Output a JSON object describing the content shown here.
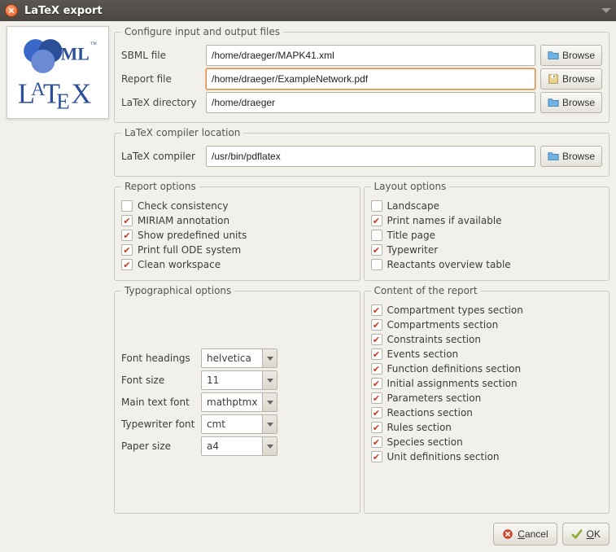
{
  "window": {
    "title": "LaTeX export"
  },
  "fieldset_io": {
    "legend": "Configure input and output files"
  },
  "io": {
    "sbml_label": "SBML file",
    "sbml_value": "/home/draeger/MAPK41.xml",
    "report_label": "Report file",
    "report_value": "/home/draeger/ExampleNetwork.pdf",
    "dir_label": "LaTeX directory",
    "dir_value": "/home/draeger",
    "browse": "Browse"
  },
  "fieldset_compiler": {
    "legend": "LaTeX compiler location"
  },
  "compiler": {
    "label": "LaTeX compiler",
    "value": "/usr/bin/pdflatex",
    "browse": "Browse"
  },
  "report_opts": {
    "legend": "Report options",
    "items": [
      {
        "label": "Check consistency",
        "checked": false
      },
      {
        "label": "MIRIAM annotation",
        "checked": true
      },
      {
        "label": "Show predefined units",
        "checked": true
      },
      {
        "label": "Print full ODE system",
        "checked": true
      },
      {
        "label": "Clean workspace",
        "checked": true
      }
    ]
  },
  "layout_opts": {
    "legend": "Layout options",
    "items": [
      {
        "label": "Landscape",
        "checked": false
      },
      {
        "label": "Print names if available",
        "checked": true
      },
      {
        "label": "Title page",
        "checked": false
      },
      {
        "label": "Typewriter",
        "checked": true
      },
      {
        "label": "Reactants overview table",
        "checked": false
      }
    ]
  },
  "typo": {
    "legend": "Typographical options",
    "rows": [
      {
        "label": "Font headings",
        "value": "helvetica"
      },
      {
        "label": "Font size",
        "value": "11"
      },
      {
        "label": "Main text font",
        "value": "mathptmx"
      },
      {
        "label": "Typewriter font",
        "value": "cmt"
      },
      {
        "label": "Paper size",
        "value": "a4"
      }
    ]
  },
  "content": {
    "legend": "Content of the report",
    "items": [
      {
        "label": "Compartment types section",
        "checked": true
      },
      {
        "label": "Compartments section",
        "checked": true
      },
      {
        "label": "Constraints section",
        "checked": true
      },
      {
        "label": "Events section",
        "checked": true
      },
      {
        "label": "Function definitions section",
        "checked": true
      },
      {
        "label": "Initial assignments section",
        "checked": true
      },
      {
        "label": "Parameters section",
        "checked": true
      },
      {
        "label": "Reactions section",
        "checked": true
      },
      {
        "label": "Rules section",
        "checked": true
      },
      {
        "label": "Species section",
        "checked": true
      },
      {
        "label": "Unit definitions section",
        "checked": true
      }
    ]
  },
  "footer": {
    "cancel": "Cancel",
    "ok": "OK"
  }
}
